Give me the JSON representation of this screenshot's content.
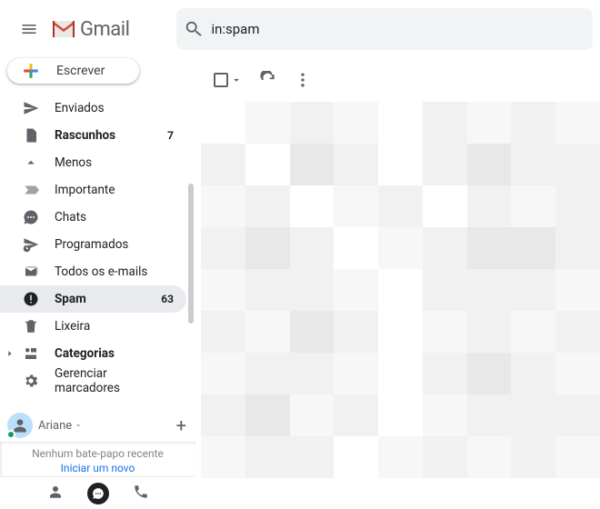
{
  "app": {
    "name": "Gmail"
  },
  "search": {
    "value": "in:spam",
    "icon": "search-icon"
  },
  "compose": {
    "label": "Escrever"
  },
  "sidebar": {
    "enviados": "Enviados",
    "rascunhos": "Rascunhos",
    "rascunhos_count": "7",
    "menos": "Menos",
    "importante": "Importante",
    "chats": "Chats",
    "programados": "Programados",
    "todos": "Todos os e-mails",
    "spam": "Spam",
    "spam_count": "63",
    "lixeira": "Lixeira",
    "categorias": "Categorias",
    "gerenciar": "Gerenciar marcadores"
  },
  "hangouts": {
    "user": "Ariane",
    "empty": "Nenhum bate-papo recente",
    "start": "Iniciar um novo"
  }
}
